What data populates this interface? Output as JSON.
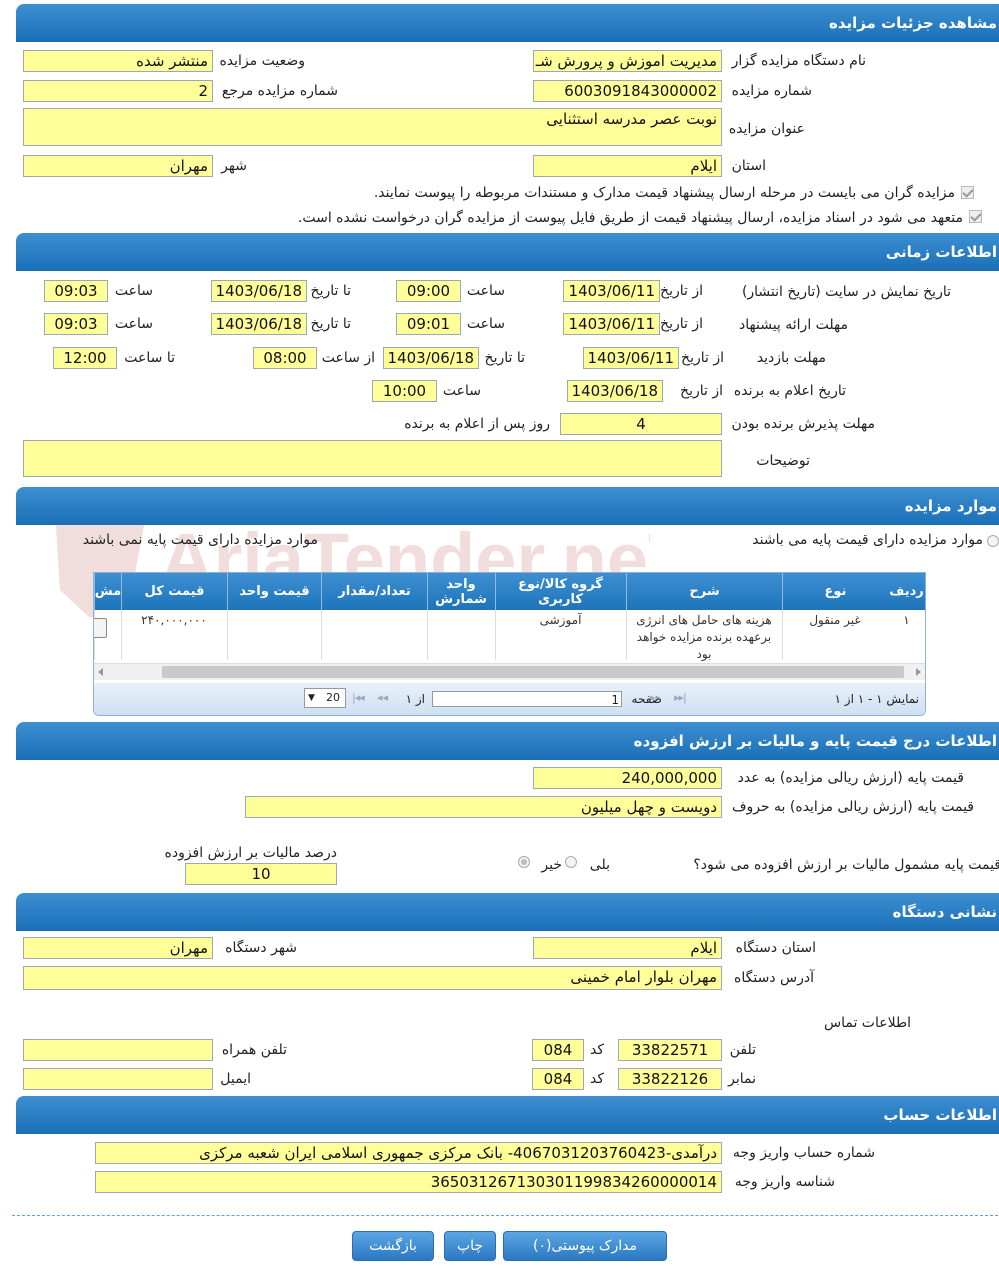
{
  "sections": {
    "details": "مشاهده جزئیات مزایده",
    "timing": "اطلاعات زمانی",
    "items": "موارد مزایده",
    "price": "اطلاعات درج قیمت پایه و مالیات بر ارزش افزوده",
    "address": "نشانی دستگاه",
    "account": "اطلاعات حساب"
  },
  "details": {
    "org_label": "نام دستگاه مزایده گزار",
    "org_value": "مدیریت اموزش و پرورش شـ",
    "status_label": "وضعیت مزایده",
    "status_value": "منتشر شده",
    "number_label": "شماره مزایده",
    "number_value": "6003091843000002",
    "ref_label": "شماره مزایده مرجع",
    "ref_value": "2",
    "title_label": "عنوان مزایده",
    "title_value": "نوبت عصر مدرسه استثنایی",
    "province_label": "استان",
    "province_value": "ایلام",
    "city_label": "شهر",
    "city_value": "مهران",
    "check1": "مزایده گران می بایست در مرحله ارسال پیشنهاد قیمت مدارک و مستندات مربوطه را پیوست نمایند.",
    "check2": "متعهد می شود در اسناد مزایده، ارسال پیشنهاد قیمت از طریق فایل پیوست از مزایده گران درخواست نشده است."
  },
  "timing": {
    "from_date": "از تاریخ",
    "to_date": "تا تاریخ",
    "hour": "ساعت",
    "from_hour": "از ساعت",
    "to_hour": "تا ساعت",
    "publish_label": "تاریخ نمایش در سایت (تاریخ انتشار)",
    "publish_from": "1403/06/11",
    "publish_from_time": "09:00",
    "publish_to": "1403/06/18",
    "publish_to_time": "09:03",
    "offer_label": "مهلت ارائه پیشنهاد",
    "offer_from": "1403/06/11",
    "offer_from_time": "09:01",
    "offer_to": "1403/06/18",
    "offer_to_time": "09:03",
    "visit_label": "مهلت بازدید",
    "visit_from": "1403/06/11",
    "visit_to": "1403/06/18",
    "visit_from_time": "08:00",
    "visit_to_time": "12:00",
    "winner_label": "تاریخ اعلام به برنده",
    "winner_date": "1403/06/18",
    "winner_time": "10:00",
    "accept_label": "مهلت پذیرش برنده بودن",
    "accept_days": "4",
    "accept_suffix": "روز پس از اعلام به برنده",
    "notes_label": "توضیحات",
    "notes_value": ""
  },
  "items": {
    "radio_has_base": "موارد مزایده دارای قیمت پایه می باشند",
    "radio_no_base": "موارد مزایده دارای قیمت پایه نمی باشند",
    "columns": [
      "ردیف",
      "نوع",
      "شرح",
      "گروه کالا/نوع کاربری",
      "واحد شمارش",
      "تعداد/مقدار",
      "قیمت واحد",
      "قیمت کل",
      "مش"
    ],
    "row": {
      "index": "۱",
      "type": "غیر منقول",
      "desc": "هزینه های حامل های انرژی برعهده برنده مزایده خواهد بود",
      "group": "آموزشی",
      "unit": "",
      "qty": "",
      "unit_price": "",
      "total": "۲۴۰,۰۰۰,۰۰۰"
    },
    "pager": {
      "summary": "نمایش ۱ - ۱ از ۱",
      "page_label": "صفحه",
      "page_value": "1",
      "of_label": "از ۱",
      "page_size": "20"
    }
  },
  "price": {
    "base_num_label": "قیمت پایه (ارزش ریالی مزایده) به عدد",
    "base_num_value": "240,000,000",
    "base_word_label": "قیمت پایه (ارزش ریالی مزایده) به حروف",
    "base_word_value": "دویست و چهل میلیون",
    "vat_question": "قیمت پایه مشمول مالیات بر ارزش افزوده می شود؟",
    "yes": "بلی",
    "no": "خیر",
    "vat_percent_label": "درصد مالیات بر ارزش افزوده",
    "vat_percent_value": "10"
  },
  "address": {
    "province_label": "استان دستگاه",
    "province_value": "ایلام",
    "city_label": "شهر دستگاه",
    "city_value": "مهران",
    "addr_label": "آدرس دستگاه",
    "addr_value": "مهران بلوار امام خمینی",
    "contact_label": "اطلاعات تماس",
    "phone_label": "تلفن",
    "phone_value": "33822571",
    "code_label": "کد",
    "phone_code": "084",
    "mobile_label": "تلفن همراه",
    "mobile_value": "",
    "fax_label": "نمابر",
    "fax_value": "33822126",
    "fax_code": "084",
    "email_label": "ایمیل",
    "email_value": ""
  },
  "account": {
    "acc_label": "شماره حساب واریز وجه",
    "acc_value": "درآمدی-4067031203760423- بانک مرکزی جمهوری اسلامی ایران شعبه مرکزی",
    "id_label": "شناسه واریز وجه",
    "id_value": "365031267130301199834260000014"
  },
  "buttons": {
    "attachments": "مدارک پیوستی(۰)",
    "print": "چاپ",
    "back": "بازگشت"
  },
  "watermark": "AriaTender.neT"
}
